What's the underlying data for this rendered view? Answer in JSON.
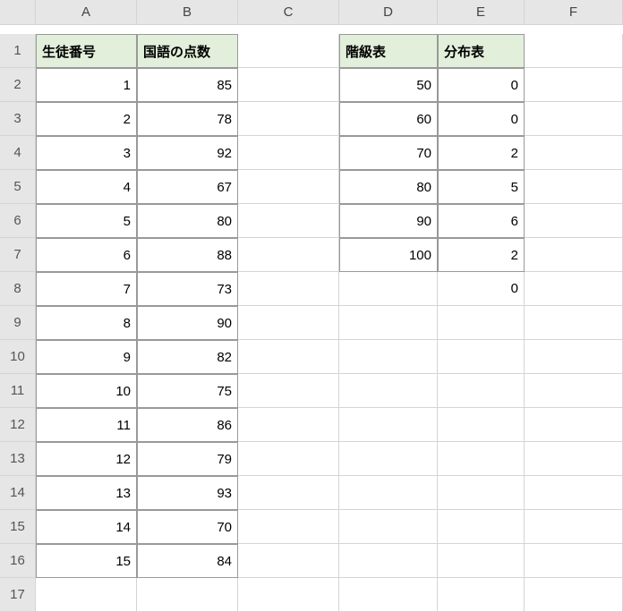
{
  "columns": [
    "A",
    "B",
    "C",
    "D",
    "E",
    "F"
  ],
  "rowCount": 17,
  "headers": {
    "A1": "生徒番号",
    "B1": "国語の点数",
    "D1": "階級表",
    "E1": "分布表"
  },
  "students": [
    {
      "id": 1,
      "score": 85
    },
    {
      "id": 2,
      "score": 78
    },
    {
      "id": 3,
      "score": 92
    },
    {
      "id": 4,
      "score": 67
    },
    {
      "id": 5,
      "score": 80
    },
    {
      "id": 6,
      "score": 88
    },
    {
      "id": 7,
      "score": 73
    },
    {
      "id": 8,
      "score": 90
    },
    {
      "id": 9,
      "score": 82
    },
    {
      "id": 10,
      "score": 75
    },
    {
      "id": 11,
      "score": 86
    },
    {
      "id": 12,
      "score": 79
    },
    {
      "id": 13,
      "score": 93
    },
    {
      "id": 14,
      "score": 70
    },
    {
      "id": 15,
      "score": 84
    }
  ],
  "distribution": [
    {
      "class": 50,
      "count": 0
    },
    {
      "class": 60,
      "count": 0
    },
    {
      "class": 70,
      "count": 2
    },
    {
      "class": 80,
      "count": 5
    },
    {
      "class": 90,
      "count": 6
    },
    {
      "class": 100,
      "count": 2
    }
  ],
  "overflowCount": 0
}
